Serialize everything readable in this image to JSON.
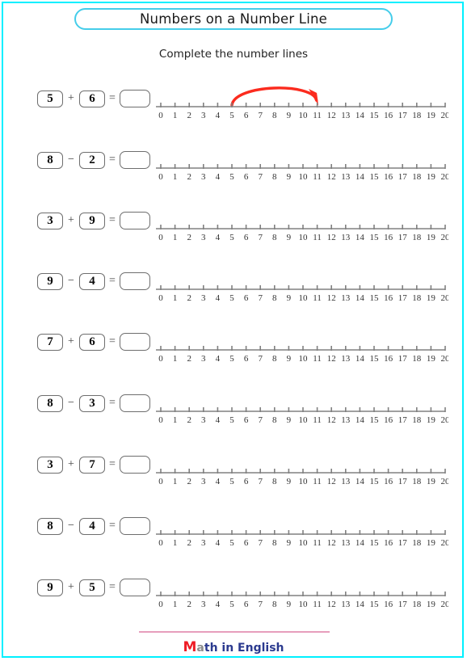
{
  "page": {
    "border_color": "#00f0ff",
    "background": "#ffffff"
  },
  "header": {
    "title": "Numbers on a Number Line",
    "title_border_color": "#45cdea",
    "subtitle": "Complete the number lines"
  },
  "numberline": {
    "min": 0,
    "max": 20,
    "labels": [
      "0",
      "1",
      "2",
      "3",
      "4",
      "5",
      "6",
      "7",
      "8",
      "9",
      "10",
      "11",
      "12",
      "13",
      "14",
      "15",
      "16",
      "17",
      "18",
      "19",
      "20"
    ],
    "line_color": "#808080",
    "tick_color": "#808080",
    "label_color": "#333333"
  },
  "arrow": {
    "color": "#fb2b1e",
    "from": 5,
    "to": 11
  },
  "problems": [
    {
      "left": "5",
      "operator": "+",
      "right": "6",
      "equals": "=",
      "answer": "",
      "has_arrow": true
    },
    {
      "left": "8",
      "operator": "−",
      "right": "2",
      "equals": "=",
      "answer": "",
      "has_arrow": false
    },
    {
      "left": "3",
      "operator": "+",
      "right": "9",
      "equals": "=",
      "answer": "",
      "has_arrow": false
    },
    {
      "left": "9",
      "operator": "−",
      "right": "4",
      "equals": "=",
      "answer": "",
      "has_arrow": false
    },
    {
      "left": "7",
      "operator": "+",
      "right": "6",
      "equals": "=",
      "answer": "",
      "has_arrow": false
    },
    {
      "left": "8",
      "operator": "−",
      "right": "3",
      "equals": "=",
      "answer": "",
      "has_arrow": false
    },
    {
      "left": "3",
      "operator": "+",
      "right": "7",
      "equals": "=",
      "answer": "",
      "has_arrow": false
    },
    {
      "left": "8",
      "operator": "−",
      "right": "4",
      "equals": "=",
      "answer": "",
      "has_arrow": false
    },
    {
      "left": "9",
      "operator": "+",
      "right": "5",
      "equals": "=",
      "answer": "",
      "has_arrow": false
    }
  ],
  "footer": {
    "logo_initial": "M",
    "logo_second": "a",
    "logo_rest": "th in English",
    "rule_color": "#e79ebc",
    "initial_color": "#ee1c25",
    "second_color": "#8c8c8c",
    "rest_color": "#2b3a8f"
  }
}
